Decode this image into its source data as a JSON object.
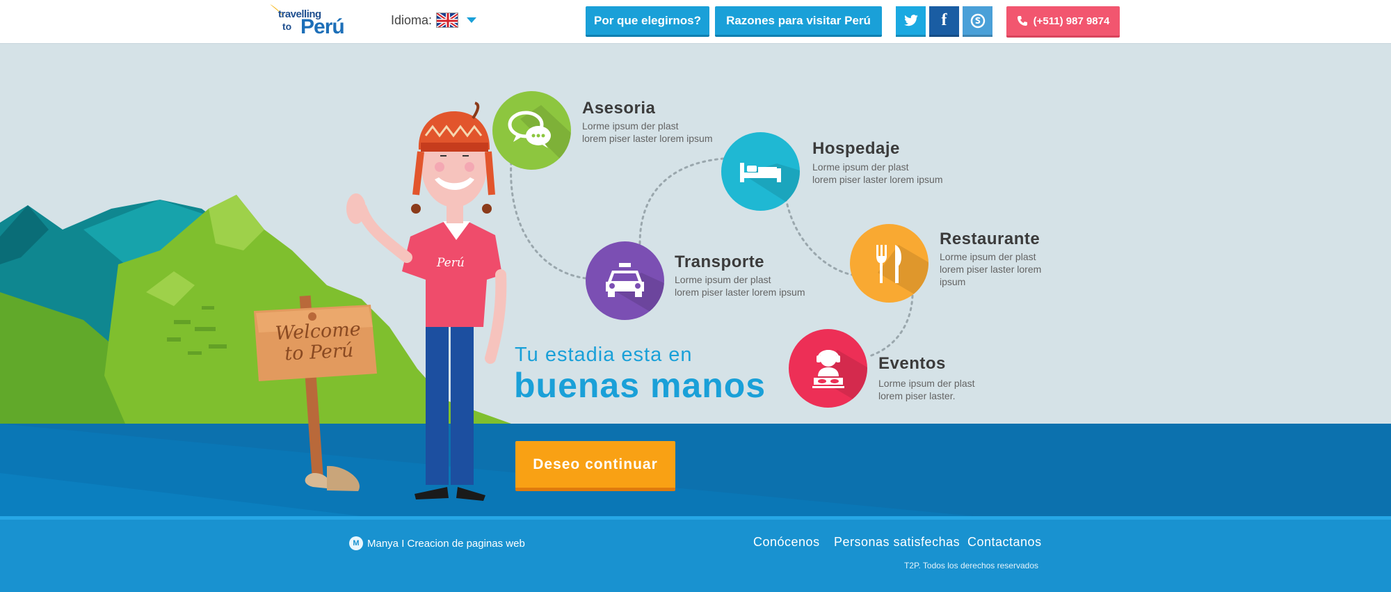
{
  "header": {
    "logo_line1": "travelling",
    "logo_line2": "to",
    "logo_line3": "Perú",
    "idioma_label": "Idioma:",
    "nav": [
      {
        "label": "Por que elegirnos?"
      },
      {
        "label": "Razones para visitar Perú"
      }
    ],
    "social": [
      {
        "icon": "twitter-icon"
      },
      {
        "icon": "facebook-icon"
      },
      {
        "icon": "skype-icon"
      }
    ],
    "phone": "(+511) 987 9874"
  },
  "hero": {
    "sign_line1": "Welcome",
    "sign_line2": "to Perú",
    "shirt_text": "Perú",
    "tagline_1": "Tu estadia esta en",
    "tagline_2": "buenas manos",
    "cta": "Deseo continuar"
  },
  "services": [
    {
      "title": "Asesoria",
      "desc1": "Lorme ipsum der plast",
      "desc2": "lorem piser laster lorem ipsum",
      "color": "#8dc63f",
      "icon": "chat-bubbles-icon"
    },
    {
      "title": "Hospedaje",
      "desc1": "Lorme ipsum der plast",
      "desc2": "lorem piser laster lorem ipsum",
      "color": "#1fb8d3",
      "icon": "bed-icon"
    },
    {
      "title": "Transporte",
      "desc1": "Lorme ipsum der plast",
      "desc2": "lorem piser laster lorem ipsum",
      "color": "#7b4fb3",
      "icon": "taxi-icon"
    },
    {
      "title": "Restaurante",
      "desc1": "Lorme ipsum der plast",
      "desc2": "lorem piser laster lorem ipsum",
      "color": "#f9a932",
      "icon": "fork-knife-icon"
    },
    {
      "title": "Eventos",
      "desc1": "Lorme ipsum der plast",
      "desc2": "lorem piser laster.",
      "color": "#ed2f56",
      "icon": "dj-icon"
    }
  ],
  "footer": {
    "credit": "Manya I Creacion de paginas web",
    "links": [
      {
        "label": "Conócenos"
      },
      {
        "label": "Personas satisfechas"
      },
      {
        "label": "Contactanos"
      }
    ],
    "copyright": "T2P. Todos los derechos reservados"
  }
}
